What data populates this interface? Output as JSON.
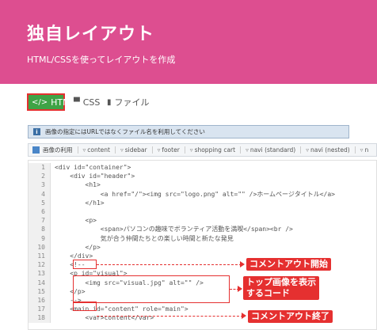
{
  "banner": {
    "title": "独自レイアウト",
    "subtitle": "HTML/CSSを使ってレイアウトを作成",
    "bg_color": "#dd4e90"
  },
  "tabs": [
    {
      "label": "HTML",
      "icon": "code-icon",
      "active": true
    },
    {
      "label": "CSS",
      "icon": "paint-roller-icon",
      "active": false
    },
    {
      "label": "ファイル",
      "icon": "files-icon",
      "active": false
    }
  ],
  "notice": {
    "text": "画像の指定にはURLではなくファイル名を利用してください"
  },
  "filter": {
    "label": "画像の利用",
    "chips": [
      "content",
      "sidebar",
      "footer",
      "shopping cart",
      "navi (standard)",
      "navi (nested)",
      "n"
    ]
  },
  "code_lines": [
    {
      "n": "1",
      "t": "<div id=\"container\">"
    },
    {
      "n": "2",
      "t": "    <div id=\"header\">"
    },
    {
      "n": "3",
      "t": "        <h1>"
    },
    {
      "n": "4",
      "t": "            <a href=\"/\"><img src=\"logo.png\" alt=\"\" />ホームページタイトル</a>"
    },
    {
      "n": "5",
      "t": "        </h1>"
    },
    {
      "n": "6",
      "t": ""
    },
    {
      "n": "7",
      "t": "        <p>"
    },
    {
      "n": "8",
      "t": "            <span>パソコンの趣味でボランティア活動を満喫</span><br />"
    },
    {
      "n": "9",
      "t": "            気が合う仲間たちとの楽しい時間と新たな発見"
    },
    {
      "n": "10",
      "t": "        </p>"
    },
    {
      "n": "11",
      "t": "    </div>"
    },
    {
      "n": "12",
      "t": "    <!--"
    },
    {
      "n": "13",
      "t": "    <p id=\"visual\">"
    },
    {
      "n": "14",
      "t": "        <img src=\"visual.jpg\" alt=\"\" />"
    },
    {
      "n": "15",
      "t": "    </p>"
    },
    {
      "n": "16",
      "t": "    -->"
    },
    {
      "n": "17",
      "t": "    <main id=\"content\" role=\"main\">"
    },
    {
      "n": "18",
      "t": "        <var>content</var>"
    }
  ],
  "annotations": {
    "comment_start": "コメントアウト開始",
    "top_image_code_1": "トップ画像を表示",
    "top_image_code_2": "するコード",
    "comment_end": "コメントアウト終了",
    "color": "#e53030"
  }
}
